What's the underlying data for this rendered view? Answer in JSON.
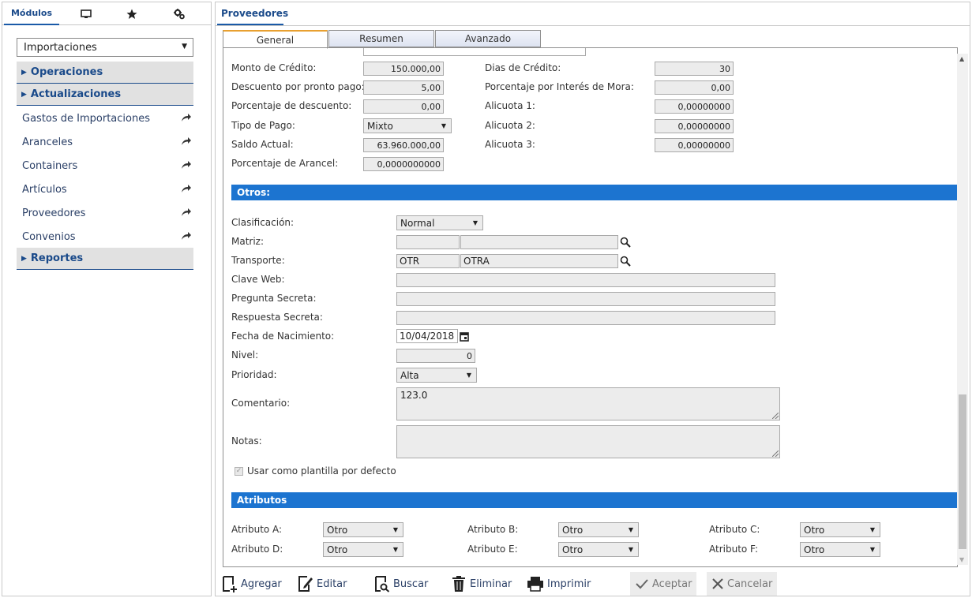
{
  "left_tabs": {
    "modules_label": "Módulos"
  },
  "module_select": "Importaciones",
  "sections": {
    "operaciones": "Operaciones",
    "actualizaciones": "Actualizaciones",
    "reportes": "Reportes"
  },
  "menu_items": [
    "Gastos de Importaciones",
    "Aranceles",
    "Containers",
    "Artículos",
    "Proveedores",
    "Convenios"
  ],
  "main_tab": "Proveedores",
  "form_tabs": [
    "General",
    "Resumen",
    "Avanzado"
  ],
  "credit": {
    "monto_credito_label": "Monto de Crédito:",
    "monto_credito": "150.000,00",
    "descuento_pronto_label": "Descuento por pronto pago:",
    "descuento_pronto": "5,00",
    "porc_descuento_label": "Porcentaje de descuento:",
    "porc_descuento": "0,00",
    "tipo_pago_label": "Tipo de Pago:",
    "tipo_pago": "Mixto",
    "saldo_label": "Saldo Actual:",
    "saldo": "63.960.000,00",
    "arancel_label": "Porcentaje de Arancel:",
    "arancel": "0,0000000000",
    "dias_credito_label": "Dias de Crédito:",
    "dias_credito": "30",
    "interes_mora_label": "Porcentaje por Interés de Mora:",
    "interes_mora": "0,00",
    "alicuota1_label": "Alicuota 1:",
    "alicuota1": "0,00000000",
    "alicuota2_label": "Alicuota 2:",
    "alicuota2": "0,00000000",
    "alicuota3_label": "Alicuota 3:",
    "alicuota3": "0,00000000"
  },
  "otros": {
    "title": "Otros:",
    "clasificacion_label": "Clasificación:",
    "clasificacion": "Normal",
    "matriz_label": "Matriz:",
    "matriz_code": "",
    "matriz_name": "",
    "transporte_label": "Transporte:",
    "transporte_code": "OTR",
    "transporte_name": "OTRA",
    "clave_web_label": "Clave Web:",
    "clave_web": "",
    "pregunta_label": "Pregunta Secreta:",
    "pregunta": "",
    "respuesta_label": "Respuesta Secreta:",
    "respuesta": "",
    "fecha_label": "Fecha de Nacimiento:",
    "fecha": "10/04/2018",
    "nivel_label": "Nivel:",
    "nivel": "0",
    "prioridad_label": "Prioridad:",
    "prioridad": "Alta",
    "comentario_label": "Comentario:",
    "comentario": "123.0",
    "notas_label": "Notas:",
    "notas": "",
    "plantilla_label": "Usar como plantilla por defecto"
  },
  "atributos": {
    "title": "Atributos",
    "a_label": "Atributo A:",
    "a": "Otro",
    "b_label": "Atributo B:",
    "b": "Otro",
    "c_label": "Atributo C:",
    "c": "Otro",
    "d_label": "Atributo D:",
    "d": "Otro",
    "e_label": "Atributo E:",
    "e": "Otro",
    "f_label": "Atributo F:",
    "f": "Otro"
  },
  "toolbar": {
    "agregar": "Agregar",
    "editar": "Editar",
    "buscar": "Buscar",
    "eliminar": "Eliminar",
    "imprimir": "Imprimir",
    "aceptar": "Aceptar",
    "cancelar": "Cancelar"
  },
  "colors": {
    "accent": "#1c74d0",
    "nav_text": "#1a4a8a",
    "active_tab_top": "#e8a030"
  }
}
